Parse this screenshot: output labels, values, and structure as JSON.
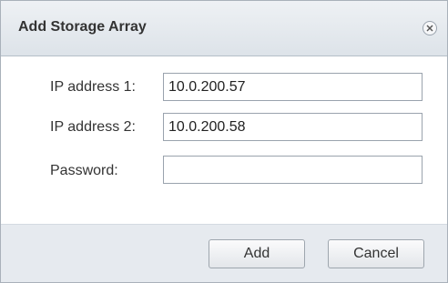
{
  "dialog": {
    "title": "Add Storage Array",
    "close_icon": "close-circle-icon"
  },
  "form": {
    "ip1": {
      "label": "IP address 1:",
      "value": "10.0.200.57",
      "placeholder": ""
    },
    "ip2": {
      "label": "IP address 2:",
      "value": "10.0.200.58",
      "placeholder": ""
    },
    "password": {
      "label": "Password:",
      "value": "",
      "placeholder": ""
    }
  },
  "footer": {
    "add_label": "Add",
    "cancel_label": "Cancel"
  }
}
